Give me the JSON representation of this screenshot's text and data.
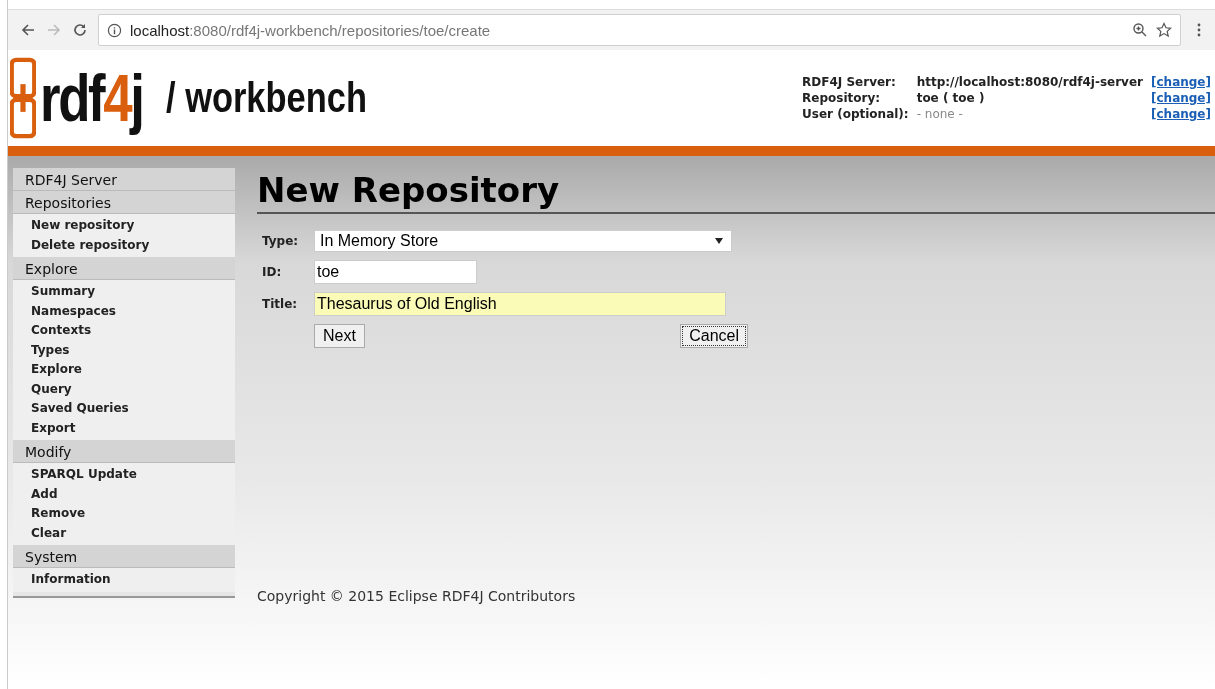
{
  "browser": {
    "url_host": "localhost",
    "url_path": ":8080/rdf4j-workbench/repositories/toe/create"
  },
  "header": {
    "logo": [
      {
        "text": "rdf",
        "accent": false
      },
      {
        "text": "4",
        "accent": true
      },
      {
        "text": "j",
        "accent": false
      }
    ],
    "subtitle": "/ workbench",
    "info": [
      {
        "label": "RDF4J Server:",
        "value": "http://localhost:8080/rdf4j-server",
        "muted": false,
        "link": "[change]"
      },
      {
        "label": "Repository:",
        "value": "toe ( toe )",
        "muted": false,
        "link": "[change]"
      },
      {
        "label": "User (optional):",
        "value": "- none -",
        "muted": true,
        "link": "[change]"
      }
    ]
  },
  "sidebar": [
    {
      "title": "RDF4J Server"
    },
    {
      "title": "Repositories",
      "items": [
        "New repository",
        "Delete repository"
      ]
    },
    {
      "title": "Explore",
      "items": [
        "Summary",
        "Namespaces",
        "Contexts",
        "Types",
        "Explore",
        "Query",
        "Saved Queries",
        "Export"
      ]
    },
    {
      "title": "Modify",
      "items": [
        "SPARQL Update",
        "Add",
        "Remove",
        "Clear"
      ]
    },
    {
      "title": "System",
      "items": [
        "Information"
      ]
    }
  ],
  "page_title": "New Repository",
  "form": {
    "type": {
      "label": "Type:",
      "value": "In Memory Store"
    },
    "id": {
      "label": "ID:",
      "value": "toe"
    },
    "title": {
      "label": "Title:",
      "value": "Thesaurus of Old English",
      "highlighted": true
    },
    "buttons": [
      {
        "label": "Next",
        "focused": false
      },
      {
        "label": "Cancel",
        "focused": true
      }
    ]
  },
  "footer": "Copyright © 2015 Eclipse RDF4J Contributors"
}
